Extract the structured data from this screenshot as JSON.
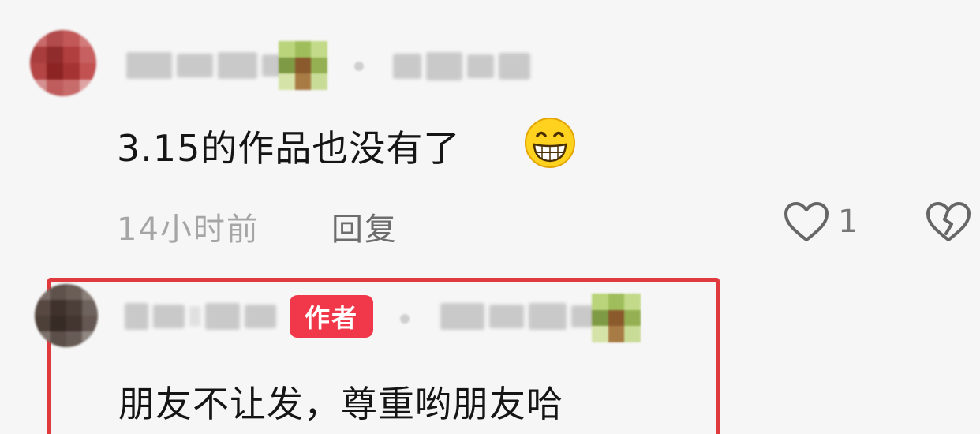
{
  "comments": [
    {
      "text": "3.15的作品也没有了",
      "emoji": "grinning-face",
      "time": "14小时前",
      "reply_label": "回复",
      "like_count": "1"
    },
    {
      "author_tag": "作者",
      "text": "朋友不让发，尊重哟朋友哈"
    }
  ],
  "colors": {
    "highlight_border": "#e03a3f",
    "author_tag_bg": "#f0384a",
    "text": "#151515",
    "muted": "#a5a5a5"
  }
}
